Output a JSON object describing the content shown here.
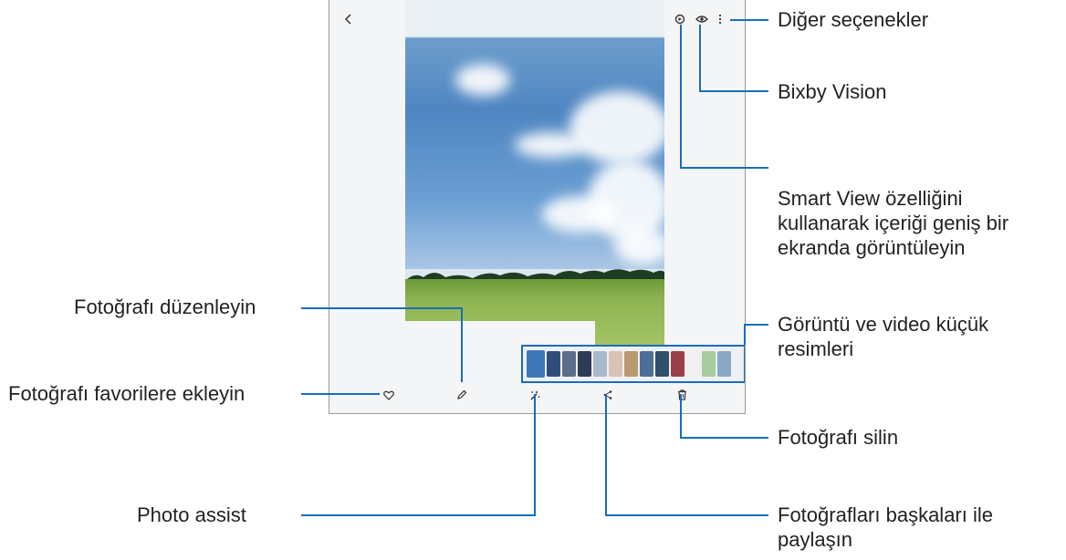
{
  "callouts": {
    "more_options": "Diğer seçenekler",
    "bixby_vision": "Bixby Vision",
    "smart_view": "Smart View özelliğini\nkullanarak içeriği geniş bir\nekranda görüntüleyin",
    "thumbnails": "Görüntü ve video küçük\nresimleri",
    "delete_photo": "Fotoğrafı silin",
    "share_photos": "Fotoğrafları başkaları ile\npaylaşın",
    "photo_assist": "Photo assist",
    "edit_photo": "Fotoğrafı düzenleyin",
    "add_favorite": "Fotoğrafı favorilere ekleyin"
  },
  "icons": {
    "back": "chevron-left-icon",
    "smart_view": "smart-view-icon",
    "bixby_vision": "eye-icon",
    "more": "more-vertical-icon",
    "favorite": "heart-icon",
    "edit": "pencil-icon",
    "photo_assist": "magic-wand-icon",
    "share": "share-icon",
    "delete": "trash-icon"
  },
  "thumbnail_colors": [
    "#3f78b8",
    "#2e4f7a",
    "#5b6e8c",
    "#2d3b58",
    "#a7b9c8",
    "#d8c3b5",
    "#b99a6e",
    "#4d6e98",
    "#2f4f6b",
    "#9a3f4a",
    "#f0f0f0",
    "#a9cc9e",
    "#8aa7c6"
  ],
  "colors": {
    "callout_line": "#1a6db8"
  }
}
